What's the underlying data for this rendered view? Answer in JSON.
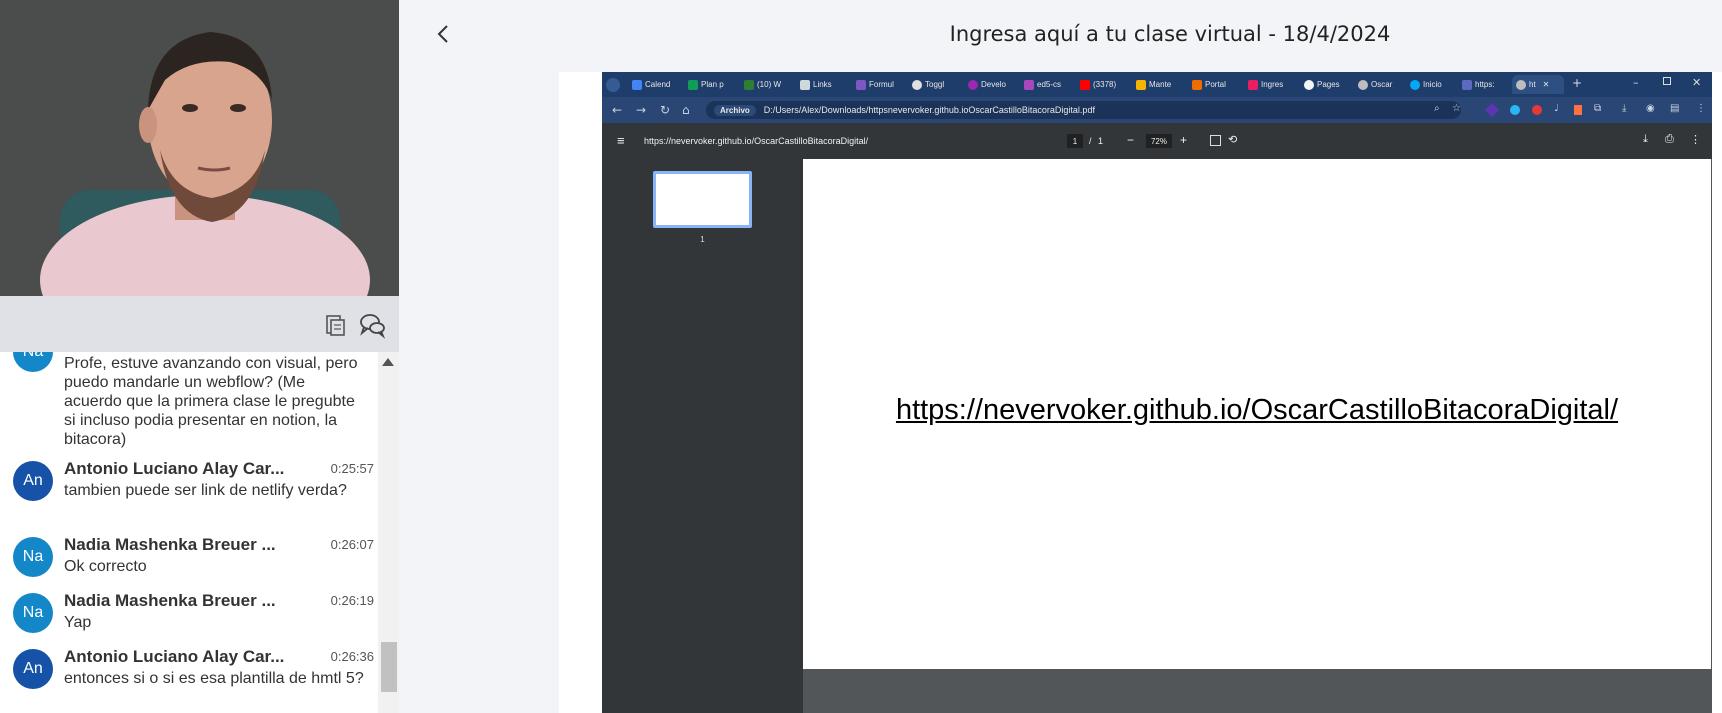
{
  "header": {
    "title": "Ingresa aquí a tu clase virtual - 18/4/2024"
  },
  "chat": {
    "messages": [
      {
        "initials": "Na",
        "name": "",
        "time": "",
        "text": "Profe, estuve avanzando con visual, pero puedo mandarle un webflow? (Me acuerdo que la primera clase le pregubte si incluso podia presentar en notion, la bitacora)"
      },
      {
        "initials": "An",
        "name": "Antonio Luciano Alay Car...",
        "time": "0:25:57",
        "text": "tambien puede ser link de netlify verda?"
      },
      {
        "initials": "Na",
        "name": "Nadia Mashenka Breuer ...",
        "time": "0:26:07",
        "text": "Ok correcto"
      },
      {
        "initials": "Na",
        "name": "Nadia Mashenka Breuer ...",
        "time": "0:26:19",
        "text": "Yap"
      },
      {
        "initials": "An",
        "name": "Antonio Luciano Alay Car...",
        "time": "0:26:36",
        "text": "entonces si o si es esa plantilla de hmtl 5?"
      }
    ]
  },
  "browser": {
    "tabs": [
      "Calend",
      "Plan p",
      "(10) W",
      "Links",
      "Formul",
      "Toggl",
      "Develo",
      "ed5-cs",
      "(3378)",
      "Mante",
      "Portal",
      "Ingres",
      "Pages",
      "Oscar",
      "Inicio",
      "https:",
      "ht"
    ],
    "address_chip": "Archivo",
    "address": "D:/Users/Alex/Downloads/httpsnevervoker.github.ioOscarCastilloBitacoraDigital.pdf"
  },
  "pdf": {
    "doc_title": "https://nevervoker.github.io/OscarCastilloBitacoraDigital/",
    "page_current": "1",
    "page_sep": "/",
    "page_total": "1",
    "zoom": "72%",
    "thumb_label": "1",
    "link_text": "https://nevervoker.github.io/OscarCastilloBitacoraDigital/"
  },
  "colors": {
    "avatar_an": "#1652a8",
    "avatar_na": "#1387c7",
    "chrome_frame": "#1f3d6b",
    "pdf_toolbar": "#323639"
  }
}
